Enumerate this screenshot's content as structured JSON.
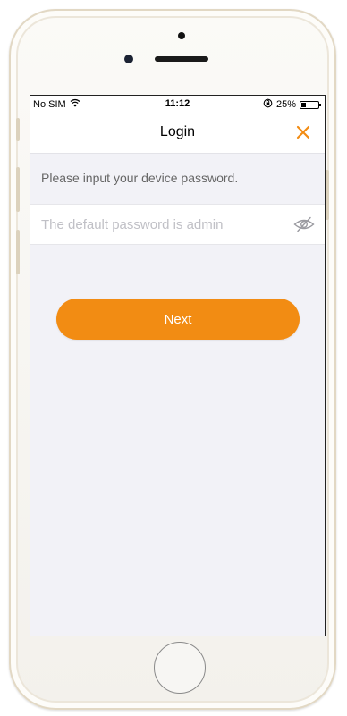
{
  "status_bar": {
    "carrier": "No SIM",
    "time": "11:12",
    "battery_text": "25%",
    "battery_level": 0.25
  },
  "nav": {
    "title": "Login",
    "close_icon": "close-x-icon"
  },
  "form": {
    "prompt": "Please input your device password.",
    "password_value": "",
    "password_placeholder": "The default password is admin",
    "visibility_icon": "eye-slash-icon"
  },
  "actions": {
    "next_label": "Next"
  },
  "colors": {
    "accent": "#f28c13",
    "background": "#f2f2f7",
    "placeholder": "#c0c0c6"
  }
}
